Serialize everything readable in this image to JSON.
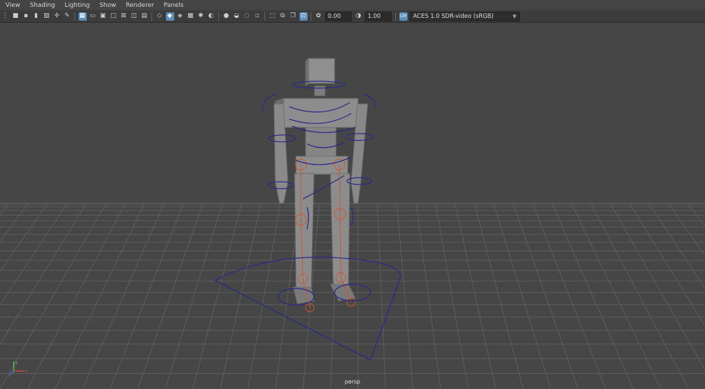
{
  "menu": {
    "items": [
      "View",
      "Shading",
      "Lighting",
      "Show",
      "Renderer",
      "Panels"
    ]
  },
  "toolbar": {
    "exposure_value": "0.00",
    "gamma_value": "1.00",
    "color_management_view": "ACES 1.0 SDR-video (sRGB)",
    "color_management_icon_label": "CM"
  },
  "viewport": {
    "camera_label": "persp",
    "axis_x": "x",
    "axis_y": "y",
    "axis_z": "z",
    "colors": {
      "background": "#464646",
      "grid": "#5e5e5e",
      "mesh": "#8a8a8a",
      "controls": "#2a2a8a",
      "joints": "#d2542b"
    }
  }
}
